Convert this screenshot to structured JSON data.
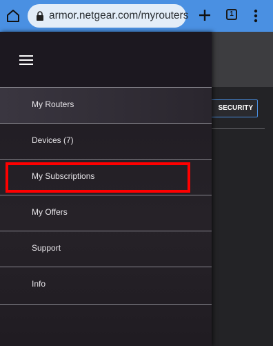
{
  "browser": {
    "url": "armor.netgear.com/myrouters",
    "tab_count": "1"
  },
  "page": {
    "security_button_label": "SECURITY"
  },
  "drawer": {
    "items": [
      {
        "label": "My Routers"
      },
      {
        "label": "Devices (7)"
      },
      {
        "label": "My Subscriptions"
      },
      {
        "label": "My Offers"
      },
      {
        "label": "Support"
      },
      {
        "label": "Info"
      }
    ]
  },
  "annotation": {
    "highlight_color": "#ff0000",
    "highlighted_item": "My Subscriptions"
  },
  "colors": {
    "chrome": "#4a90e2",
    "accent_border": "#4a8fe0"
  }
}
